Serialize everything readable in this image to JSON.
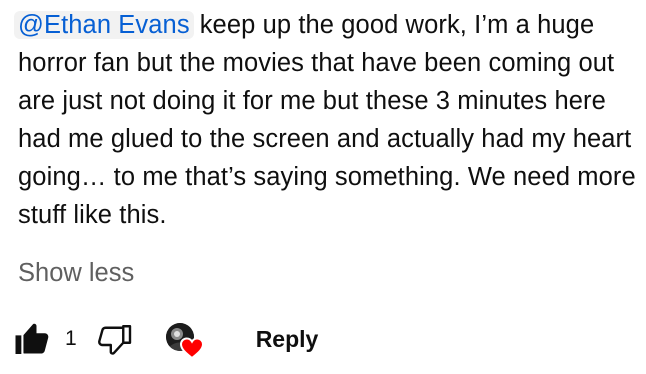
{
  "comment": {
    "mention": "@Ethan Evans",
    "text": "keep up the good work, I’m a huge horror fan but the movies that have been coming out are just not doing it for me but these 3 minutes here had me glued to the screen and actually had my heart going… to me that’s saying something. We need more stuff like this.",
    "show_less": "Show less"
  },
  "actions": {
    "like_icon": "thumbs-up-icon",
    "like_count": "1",
    "dislike_icon": "thumbs-down-icon",
    "heart_icon": "creator-heart-icon",
    "heart_color": "#ff0000",
    "reply_label": "Reply"
  }
}
